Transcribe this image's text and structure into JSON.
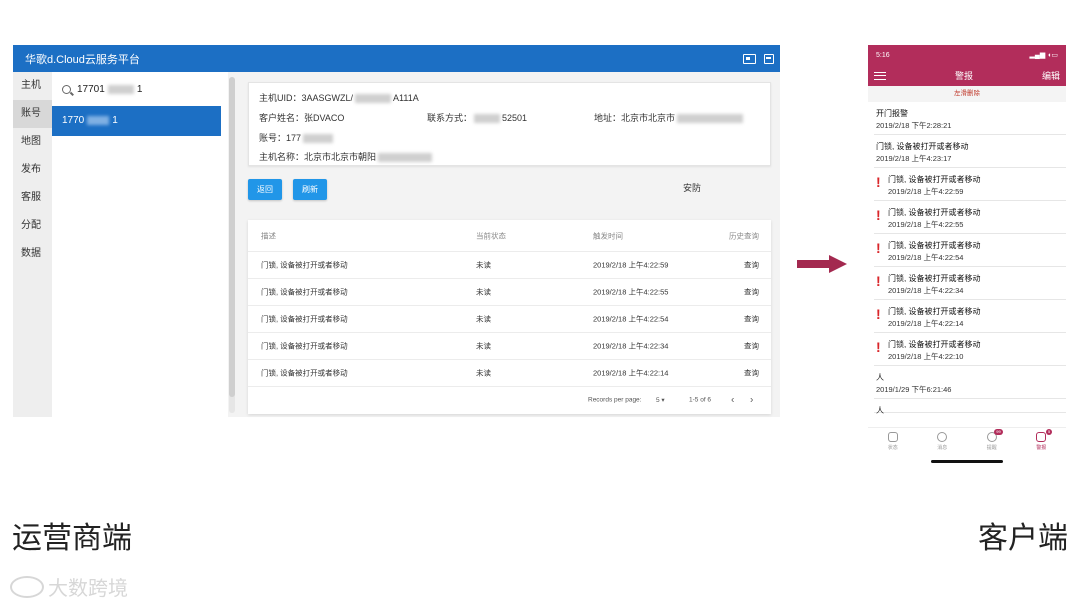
{
  "web": {
    "title": "华歌d.Cloud云服务平台",
    "nav": [
      "主机",
      "账号",
      "地图",
      "发布",
      "客服",
      "分配",
      "数据"
    ],
    "search_value": "17701",
    "search_suffix": "1",
    "selected_account_prefix": "1770",
    "selected_account_suffix": "1",
    "info": {
      "host_uid_prefix": "主机UID：3AASGWZL/",
      "host_uid_suffix": "A111A",
      "customer_name": "客户姓名：张DVACO",
      "contact_label": "联系方式：",
      "contact_suffix": "52501",
      "address": "地址：北京市北京市",
      "account": "账号：177",
      "host_name": "主机名称：北京市北京市朝阳"
    },
    "buttons": {
      "back": "返回",
      "refresh": "刷新"
    },
    "security_label": "安防",
    "table": {
      "headers": [
        "描述",
        "当前状态",
        "触发时间",
        "历史查询"
      ],
      "rows": [
        [
          "门锁, 设备被打开或者移动",
          "未读",
          "2019/2/18 上午4:22:59",
          "查询"
        ],
        [
          "门锁, 设备被打开或者移动",
          "未读",
          "2019/2/18 上午4:22:55",
          "查询"
        ],
        [
          "门锁, 设备被打开或者移动",
          "未读",
          "2019/2/18 上午4:22:54",
          "查询"
        ],
        [
          "门锁, 设备被打开或者移动",
          "未读",
          "2019/2/18 上午4:22:34",
          "查询"
        ],
        [
          "门锁, 设备被打开或者移动",
          "未读",
          "2019/2/18 上午4:22:14",
          "查询"
        ]
      ],
      "records_per_page_label": "Records per page:",
      "records_per_page": "5",
      "range": "1-5 of 6",
      "prev": "‹",
      "next": "›"
    }
  },
  "phone": {
    "time": "5:16",
    "title": "警报",
    "edit": "编辑",
    "swipe_hint": "左滑删除",
    "alerts": [
      {
        "title": "开门报警",
        "date": "2019/2/18 下午2:28:21",
        "alert": false
      },
      {
        "title": "门锁, 设备被打开或者移动",
        "date": "2019/2/18 上午4:23:17",
        "alert": false
      },
      {
        "title": "门锁, 设备被打开或者移动",
        "date": "2019/2/18 上午4:22:59",
        "alert": true
      },
      {
        "title": "门锁, 设备被打开或者移动",
        "date": "2019/2/18 上午4:22:55",
        "alert": true
      },
      {
        "title": "门锁, 设备被打开或者移动",
        "date": "2019/2/18 上午4:22:54",
        "alert": true
      },
      {
        "title": "门锁, 设备被打开或者移动",
        "date": "2019/2/18 上午4:22:34",
        "alert": true
      },
      {
        "title": "门锁, 设备被打开或者移动",
        "date": "2019/2/18 上午4:22:14",
        "alert": true
      },
      {
        "title": "门锁, 设备被打开或者移动",
        "date": "2019/2/18 上午4:22:10",
        "alert": true
      },
      {
        "title": "人",
        "date": "2019/1/29 下午6:21:46",
        "alert": false
      },
      {
        "title": "人",
        "date": "",
        "alert": false
      }
    ],
    "tabs": [
      {
        "label": "状态",
        "badge": ""
      },
      {
        "label": "消息",
        "badge": ""
      },
      {
        "label": "提醒",
        "badge": "99"
      },
      {
        "label": "警报",
        "badge": "5"
      }
    ]
  },
  "captions": {
    "left": "运营商端",
    "right": "客户端"
  },
  "watermark": "大数跨境",
  "colors": {
    "web_header": "#1c6fc4",
    "phone_accent": "#b22d5b",
    "arrow": "#a3294f"
  }
}
